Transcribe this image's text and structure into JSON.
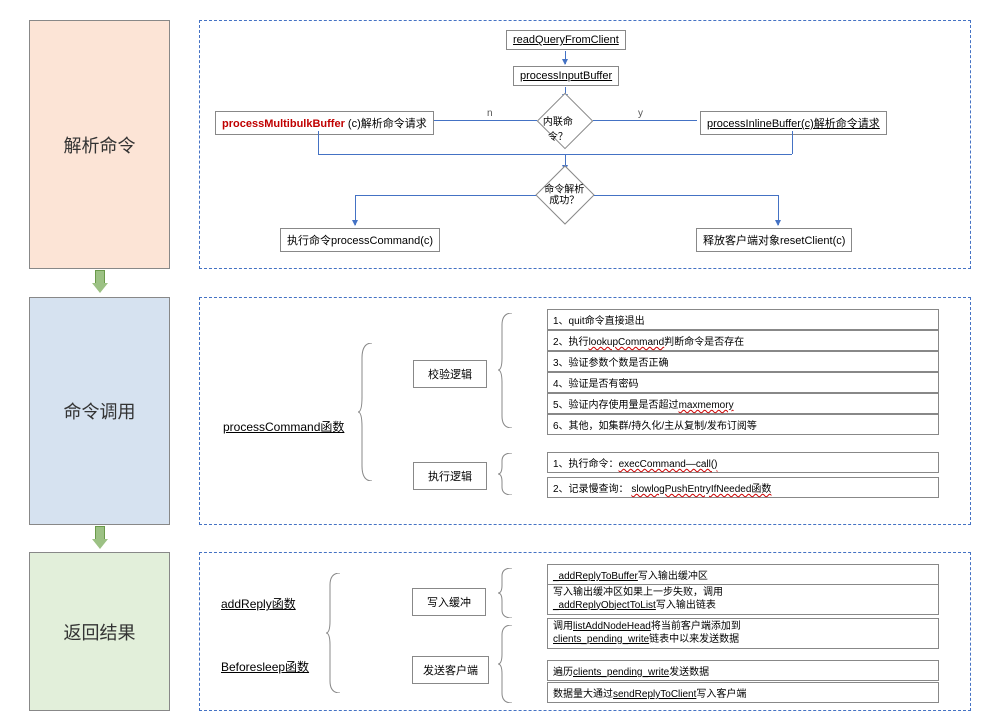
{
  "stages": {
    "parse": "解析命令",
    "invoke": "命令调用",
    "return": "返回结果"
  },
  "flow": {
    "readQuery": "readQueryFromClient",
    "processInput": "processInputBuffer",
    "multibulk_fn": "processMultibulkBuffer",
    "multibulk_suffix": " (c)解析命令请求",
    "inline": "processInlineBuffer(c)解析命令请求",
    "d1": "内联命令？",
    "d2": "命令解析\n成功？",
    "n": "n",
    "y": "y",
    "exec": "执行命令processCommand(c)",
    "reset": "释放客户端对象resetClient(c)"
  },
  "invoke": {
    "fn": "processCommand函数",
    "validate": "校验逻辑",
    "execute": "执行逻辑",
    "v1": "1、quit命令直接退出",
    "v2": "2、执行lookupCommand判断命令是否存在",
    "v3": "3、验证参数个数是否正确",
    "v4": "4、验证是否有密码",
    "v5_a": "5、验证内存使用量是否超过",
    "v5_b": "maxmemory",
    "v6": "6、其他，如集群/持久化/主从复制/发布订阅等",
    "e1_a": "1、执行命令：",
    "e1_b": "execCommand—call()",
    "e2_a": "2、记录慢查询：   ",
    "e2_b": "slowlogPushEntryIfNeeded函数"
  },
  "ret": {
    "addReply": "addReply函数",
    "beforesleep": "Beforesleep函数",
    "writeBuf": "写入缓冲",
    "sendClient": "发送客户端",
    "r1_a": " ",
    "r1_b": "_addReplyToBuffer",
    "r1_c": "写入输出缓冲区",
    "r2_a": "写入输出缓冲区如果上一步失败，调用",
    "r2_b": "_addReplyObjectToList",
    "r2_c": "写入输出链表",
    "r3_a": "调用",
    "r3_b": "listAddNodeHead",
    "r3_c": "将当前客户端添加到",
    "r3_d": "clients_pending_write",
    "r3_e": "链表中以来发送数据",
    "r4_a": "遍历",
    "r4_b": "clients_pending_write",
    "r4_c": "发送数据",
    "r5_a": "数据量大通过",
    "r5_b": "sendReplyToClient",
    "r5_c": "写入客户端"
  }
}
